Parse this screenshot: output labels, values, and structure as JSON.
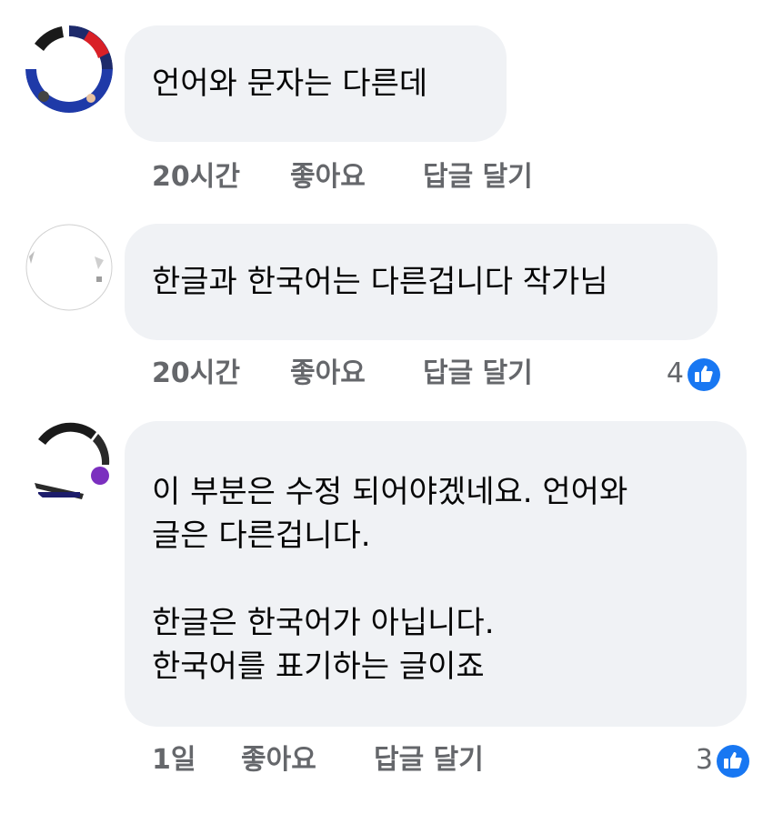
{
  "colors": {
    "bubble_bg": "#f0f2f5",
    "text": "#050505",
    "meta": "#65676b",
    "like_blue": "#1877f2"
  },
  "comments": [
    {
      "text": "언어와 문자는 다른데",
      "time": "20시간",
      "like_label": "좋아요",
      "reply_label": "답글 달기",
      "reaction_count": null,
      "avatar_icon": "profile-avatar"
    },
    {
      "text": "한글과 한국어는 다른겁니다 작가님",
      "time": "20시간",
      "like_label": "좋아요",
      "reply_label": "답글 달기",
      "reaction_count": "4",
      "reaction_icon": "thumbs-up-icon",
      "avatar_icon": "profile-avatar"
    },
    {
      "text": "이 부분은 수정 되어야겠네요. 언어와\n글은 다른겁니다.\n\n한글은 한국어가 아닙니다.\n한국어를 표기하는 글이죠",
      "time": "1일",
      "like_label": "좋아요",
      "reply_label": "답글 달기",
      "reaction_count": "3",
      "reaction_icon": "thumbs-up-icon",
      "avatar_icon": "profile-avatar"
    }
  ]
}
